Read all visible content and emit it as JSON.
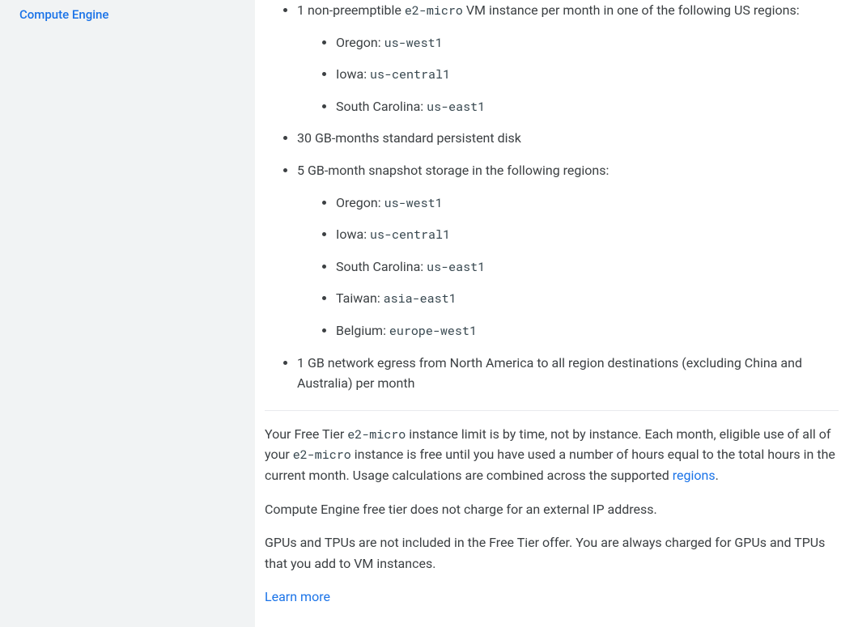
{
  "sidebar": {
    "title": "Compute Engine"
  },
  "main": {
    "item1_prefix": "1 non-preemptible ",
    "item1_code": "e2-micro",
    "item1_suffix": " VM instance per month in one of the following US regions:",
    "regions1": [
      {
        "label": "Oregon: ",
        "code": "us-west1"
      },
      {
        "label": "Iowa: ",
        "code": "us-central1"
      },
      {
        "label": "South Carolina: ",
        "code": "us-east1"
      }
    ],
    "item2": "30 GB-months standard persistent disk",
    "item3": "5 GB-month snapshot storage in the following regions:",
    "regions2": [
      {
        "label": "Oregon: ",
        "code": "us-west1"
      },
      {
        "label": "Iowa: ",
        "code": "us-central1"
      },
      {
        "label": "South Carolina: ",
        "code": "us-east1"
      },
      {
        "label": "Taiwan: ",
        "code": "asia-east1"
      },
      {
        "label": "Belgium: ",
        "code": "europe-west1"
      }
    ],
    "item4": "1 GB network egress from North America to all region destinations (excluding China and Australia) per month",
    "para1_a": "Your Free Tier ",
    "para1_code1": "e2-micro",
    "para1_b": " instance limit is by time, not by instance. Each month, eligible use of all of your ",
    "para1_code2": "e2-micro",
    "para1_c": " instance is free until you have used a number of hours equal to the total hours in the current month. Usage calculations are combined across the supported ",
    "para1_link": "regions",
    "para1_d": ".",
    "para2": "Compute Engine free tier does not charge for an external IP address.",
    "para3": "GPUs and TPUs are not included in the Free Tier offer. You are always charged for GPUs and TPUs that you add to VM instances.",
    "learn_more": "Learn more"
  }
}
